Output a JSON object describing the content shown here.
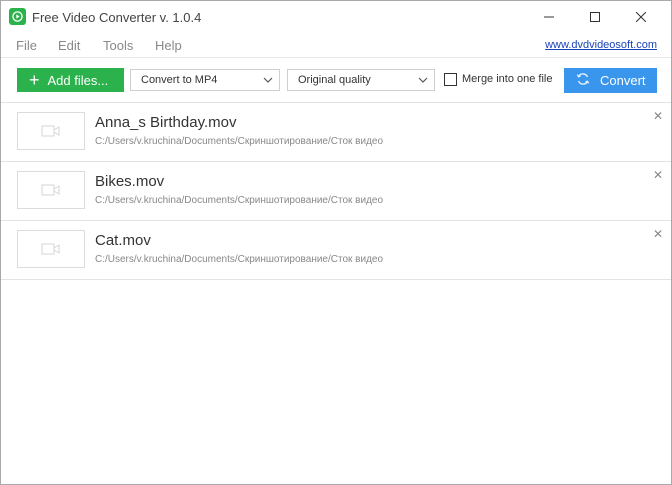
{
  "window": {
    "title": "Free Video Converter v. 1.0.4",
    "minimize_glyph": "—",
    "maximize_glyph": "☐",
    "close_glyph": "✕"
  },
  "menu": {
    "items": [
      "File",
      "Edit",
      "Tools",
      "Help"
    ],
    "site_link": "www.dvdvideosoft.com"
  },
  "toolbar": {
    "add_files_label": "Add files...",
    "format_selected": "Convert to MP4",
    "quality_selected": "Original quality",
    "merge_label": "Merge into one file",
    "merge_checked": false,
    "convert_label": "Convert"
  },
  "files": [
    {
      "name": "Anna_s Birthday.mov",
      "path": "C:/Users/v.kruchina/Documents/Скриншотирование/Сток видео"
    },
    {
      "name": "Bikes.mov",
      "path": "C:/Users/v.kruchina/Documents/Скриншотирование/Сток видео"
    },
    {
      "name": "Cat.mov",
      "path": "C:/Users/v.kruchina/Documents/Скриншотирование/Сток видео"
    }
  ],
  "colors": {
    "accent_green": "#2bb24c",
    "accent_blue": "#3a96ec",
    "link_blue": "#1a43b8"
  }
}
